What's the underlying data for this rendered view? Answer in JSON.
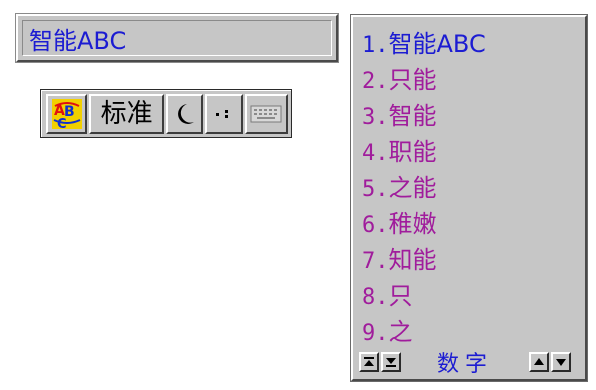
{
  "composition": {
    "text": "智能ABC"
  },
  "status_bar": {
    "logo_icon": "ime-logo-icon",
    "mode_label": "标准",
    "shape_icon": "half-width-moon-icon",
    "punct_icon": "punctuation-icon",
    "keyboard_icon": "soft-keyboard-icon"
  },
  "candidates": {
    "items": [
      {
        "num": "1.",
        "text": "智能ABC"
      },
      {
        "num": "2.",
        "text": "只能"
      },
      {
        "num": "3.",
        "text": "智能"
      },
      {
        "num": "4.",
        "text": "职能"
      },
      {
        "num": "5.",
        "text": "之能"
      },
      {
        "num": "6.",
        "text": "稚嫩"
      },
      {
        "num": "7.",
        "text": "知能"
      },
      {
        "num": "8.",
        "text": "只"
      },
      {
        "num": "9.",
        "text": "之"
      }
    ],
    "footer_label": "数字"
  },
  "colors": {
    "selected": "#1c1cd2",
    "candidate": "#a01c9c",
    "face": "#c6c6c6"
  }
}
